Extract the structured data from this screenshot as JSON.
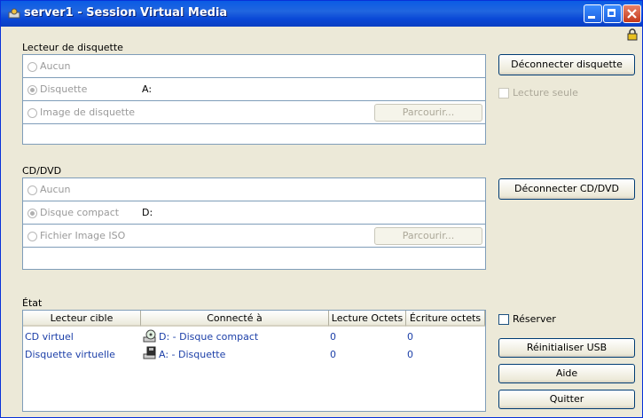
{
  "window": {
    "title": "server1 - Session Virtual Media"
  },
  "floppy": {
    "section_label": "Lecteur de disquette",
    "option_none": "Aucun",
    "option_floppy": "Disquette",
    "floppy_drive": "A:",
    "option_image": "Image de disquette",
    "browse_label": "Parcourir...",
    "disconnect_label": "Déconnecter disquette",
    "readonly_label": "Lecture seule"
  },
  "cd": {
    "section_label": "CD/DVD",
    "option_none": "Aucun",
    "option_cd": "Disque compact",
    "cd_drive": "D:",
    "option_iso": "Fichier Image ISO",
    "browse_label": "Parcourir...",
    "disconnect_label": "Déconnecter CD/DVD"
  },
  "status": {
    "section_label": "État",
    "columns": [
      "Lecteur cible",
      "Connecté à",
      "Lecture Octets",
      "Écriture octets"
    ],
    "rows": [
      {
        "target": "CD virtuel",
        "connected": "D: - Disque compact",
        "read": "0",
        "write": "0",
        "icon": "cd-drive-icon"
      },
      {
        "target": "Disquette virtuelle",
        "connected": "A: - Disquette",
        "read": "0",
        "write": "0",
        "icon": "floppy-drive-icon"
      }
    ]
  },
  "actions": {
    "reserve_label": "Réserver",
    "reset_usb_label": "Réinitialiser USB",
    "help_label": "Aide",
    "quit_label": "Quitter"
  },
  "colors": {
    "titlebar": "#0a5be5",
    "dialog": "#ece9d8",
    "link_text": "#1c3fa8"
  }
}
